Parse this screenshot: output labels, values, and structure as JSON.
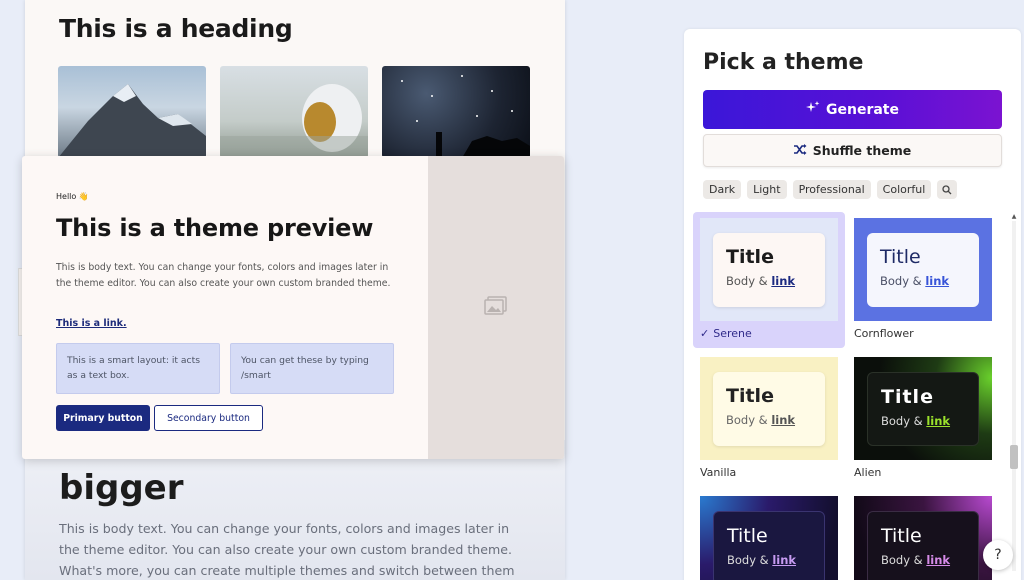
{
  "deck": {
    "heading": "This is a heading",
    "lower_heading": "bigger",
    "lower_body": "This is body text. You can change your fonts, colors and images later in the theme editor. You can also create your own custom branded theme. What's more, you can create multiple themes and switch between them at any time."
  },
  "preview": {
    "hello": "Hello 👋",
    "title": "This is a theme preview",
    "body": "This is body text. You can change your fonts, colors and images later in the theme editor. You can also create your own custom branded theme.",
    "link": "This is a link.",
    "box1": "This is a smart layout: it acts as a text box.",
    "box2": "You can get these by typing /smart",
    "primary_button": "Primary button",
    "secondary_button": "Secondary button"
  },
  "panel": {
    "title": "Pick a theme",
    "generate": "Generate",
    "shuffle": "Shuffle theme",
    "chips": [
      "Dark",
      "Light",
      "Professional",
      "Colorful"
    ],
    "themes": [
      {
        "name": "Serene",
        "title": "Title",
        "body": "Body &",
        "link": "link",
        "selected": true,
        "check": "✓"
      },
      {
        "name": "Cornflower",
        "title": "Title",
        "body": "Body &",
        "link": "link",
        "selected": false
      },
      {
        "name": "Vanilla",
        "title": "Title",
        "body": "Body &",
        "link": "link",
        "selected": false
      },
      {
        "name": "Alien",
        "title": "Title",
        "body": "Body &",
        "link": "link",
        "selected": false
      },
      {
        "name": "",
        "title": "Title",
        "body": "Body &",
        "link": "link",
        "selected": false
      },
      {
        "name": "",
        "title": "Title",
        "body": "Body &",
        "link": "link",
        "selected": false
      }
    ]
  },
  "help": "?",
  "colors": {
    "generate_start": "#3b17d8",
    "generate_end": "#7b13d1",
    "preview_primary": "#1b2a80",
    "selected_tile": "#d9d3fb"
  }
}
